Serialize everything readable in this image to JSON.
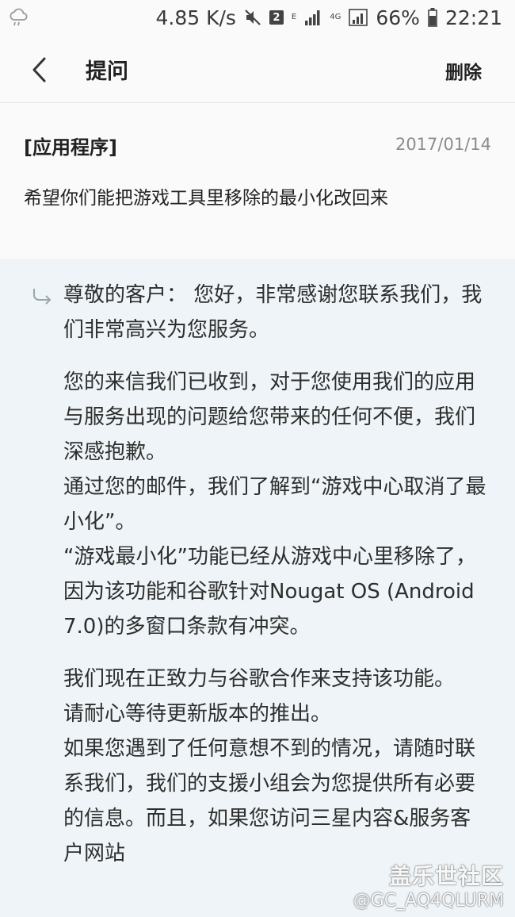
{
  "status_bar": {
    "speed": "4.85 K/s",
    "sim": "2",
    "net_e": "E",
    "net_4g": "4G",
    "battery": "66%",
    "time": "22:21"
  },
  "app_bar": {
    "title": "提问",
    "delete_label": "删除"
  },
  "question": {
    "category": "[应用程序]",
    "date": "2017/01/14",
    "text": "希望你们能把游戏工具里移除的最小化改回来"
  },
  "answer": {
    "para1": "尊敬的客户： 您好，非常感谢您联系我们，我们非常高兴为您服务。",
    "para2": "您的来信我们已收到，对于您使用我们的应用与服务出现的问题给您带来的任何不便，我们深感抱歉。",
    "para3": "通过您的邮件，我们了解到“游戏中心取消了最小化”。",
    "para4": "“游戏最小化”功能已经从游戏中心里移除了，因为该功能和谷歌针对Nougat OS (Android 7.0)的多窗口条款有冲突。",
    "para5": "我们现在正致力与谷歌合作来支持该功能。",
    "para6": "请耐心等待更新版本的推出。",
    "para7": "如果您遇到了任何意想不到的情况，请随时联系我们，我们的支援小组会为您提供所有必要的信息。而且，如果您访问三星内容&服务客户网站"
  },
  "watermark": {
    "brand": "盖乐世社区",
    "user": "@GC_AQ4QLURM"
  }
}
